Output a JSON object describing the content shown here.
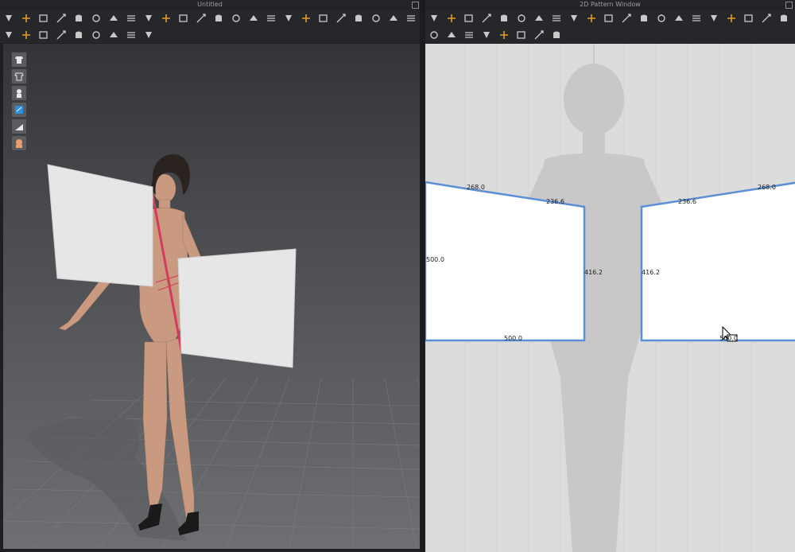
{
  "window": {
    "left_title": "Untitled",
    "right_title": "2D Pattern Window"
  },
  "toolbar_3d_icons": [
    "move-down-icon",
    "transform-pin-icon",
    "select-box-icon",
    "resize-box-icon",
    "rotate-icon",
    "garment-select-icon",
    "seam-icon",
    "magic-icon",
    "fold-icon",
    "shirt-icon",
    "shirt-outline-icon",
    "flag-icon",
    "arrow-icon",
    "sew-icon",
    "tape-icon",
    "hanger-icon",
    "pull-icon",
    "avatar-walk-icon",
    "arrangement-icon",
    "pin-icon",
    "cut-icon",
    "piece-icon",
    "tack-icon",
    "heart-pin-icon",
    "diamond-icon",
    "point-icon",
    "circle-point-icon",
    "line-icon",
    "button-icon",
    "zipper-icon",
    "measure-icon",
    "ruler-icon",
    "split-icon"
  ],
  "toolbar_2d_icons": [
    "edit-pattern-icon",
    "transform-icon",
    "edit-point-icon",
    "curve-point-icon",
    "add-point-icon",
    "edit-curvature-icon",
    "circle-icon",
    "polygon-icon",
    "rectangle-icon",
    "ellipse-icon",
    "internal-polygon-icon",
    "internal-rectangle-icon",
    "internal-circle-icon",
    "dart-icon",
    "parallel-icon",
    "segment-sew-icon",
    "free-sew-icon",
    "check-sew-icon",
    "tape-sew-icon",
    "select-sew-icon",
    "trace-icon",
    "clone-icon",
    "symmetry-icon",
    "unfold-icon",
    "fold-line-icon",
    "dashed-line-icon",
    "wave-line-icon",
    "slash-line-icon",
    "grid-icon"
  ],
  "side_tools": [
    "shirt-view-icon",
    "shirt-texture-icon",
    "avatar-view-icon",
    "paint-icon",
    "shade-icon",
    "skin-icon"
  ],
  "pattern_left": {
    "top_left_measure": "268.0",
    "top_right_measure": "236.6",
    "left_measure": "500.0",
    "right_measure": "416.2",
    "bottom_measure": "500.0"
  },
  "pattern_right": {
    "top_left_measure": "236.6",
    "top_right_measure": "268.0",
    "left_measure": "416.2",
    "bottom_measure": "500.0"
  },
  "colors": {
    "pattern_outline": "#5b8fd6",
    "seam_line": "#d43a5e",
    "panel_gray": "#e0e0e0"
  }
}
